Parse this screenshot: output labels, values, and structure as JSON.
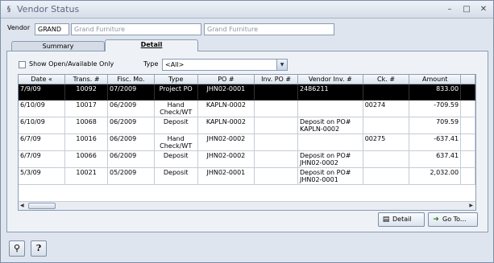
{
  "window": {
    "title": "Vendor Status"
  },
  "vendor": {
    "label": "Vendor",
    "code": "GRAND",
    "name_placeholder": "Grand Furniture",
    "name_value": "Grand Furniture"
  },
  "tabs": [
    {
      "label": "Summary"
    },
    {
      "label": "Detail"
    }
  ],
  "filters": {
    "show_open_label": "Show Open/Available Only",
    "type_label": "Type",
    "type_value": "<All>"
  },
  "table": {
    "columns": [
      "Date «",
      "Trans. #",
      "Fisc. Mo.",
      "Type",
      "PO #",
      "Inv. PO #",
      "Vendor Inv. #",
      "Ck. #",
      "Amount"
    ],
    "rows": [
      {
        "date": "7/9/09",
        "trans": "10092",
        "fisc": "07/2009",
        "type": "Project PO",
        "po": "JHN02-0001",
        "inv_po": "",
        "vendor_inv": "2486211",
        "ck": "",
        "amount": "833.00",
        "selected": true
      },
      {
        "date": "6/10/09",
        "trans": "10017",
        "fisc": "06/2009",
        "type": "Hand Check/WT",
        "po": "KAPLN-0002",
        "inv_po": "",
        "vendor_inv": "",
        "ck": "00274",
        "amount": "-709.59",
        "selected": false
      },
      {
        "date": "6/10/09",
        "trans": "10068",
        "fisc": "06/2009",
        "type": "Deposit",
        "po": "KAPLN-0002",
        "inv_po": "",
        "vendor_inv": "Deposit on PO# KAPLN-0002",
        "ck": "",
        "amount": "709.59",
        "selected": false
      },
      {
        "date": "6/7/09",
        "trans": "10016",
        "fisc": "06/2009",
        "type": "Hand Check/WT",
        "po": "JHN02-0002",
        "inv_po": "",
        "vendor_inv": "",
        "ck": "00275",
        "amount": "-637.41",
        "selected": false
      },
      {
        "date": "6/7/09",
        "trans": "10066",
        "fisc": "06/2009",
        "type": "Deposit",
        "po": "JHN02-0002",
        "inv_po": "",
        "vendor_inv": "Deposit on PO# JHN02-0002",
        "ck": "",
        "amount": "637.41",
        "selected": false
      },
      {
        "date": "5/3/09",
        "trans": "10021",
        "fisc": "05/2009",
        "type": "Deposit",
        "po": "JHN02-0001",
        "inv_po": "",
        "vendor_inv": "Deposit on PO# JHN02-0001",
        "ck": "",
        "amount": "2,032.00",
        "selected": false
      }
    ]
  },
  "buttons": {
    "detail": "Detail",
    "goto": "Go To..."
  }
}
